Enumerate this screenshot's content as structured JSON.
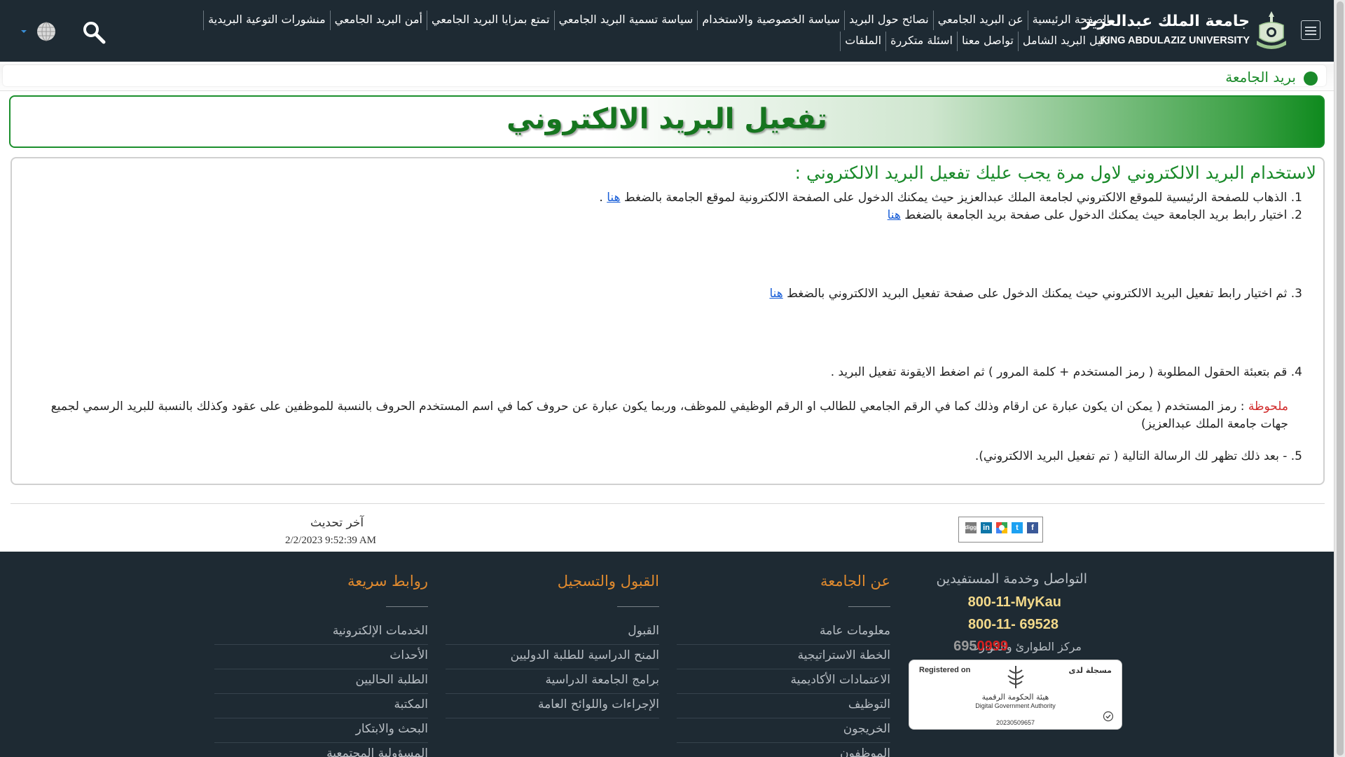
{
  "header": {
    "brand_ar": "جامعة الملك عبدالعزيز",
    "brand_en": "KING ABDULAZIZ UNIVERSITY",
    "nav_row1": [
      "الصفحة الرئيسية",
      "عن البريد الجامعي",
      "نصائح حول البريد",
      "سياسة الخصوصية والاستخدام",
      "سياسة تسمية البريد الجامعي",
      "تمتع بمزايا البريد الجامعي",
      "أمن البريد الجامعي",
      "منشورات التوعية البريدية"
    ],
    "nav_row2": [
      "دليل البريد الشامل",
      "تواصل معنا",
      "اسئلة متكررة",
      "الملفات"
    ]
  },
  "breadcrumb": {
    "label": "بريد الجامعة"
  },
  "banner": {
    "title": "تفعيل البريد الالكتروني"
  },
  "content": {
    "heading": "لاستخدام البريد الالكتروني لاول مرة يجب عليك تفعيل البريد الالكتروني :",
    "step1_prefix": "1. الذهاب للصفحة الرئيسية للموقع الالكتروني لجامعة الملك عبدالعزيز حيث يمكنك الدخول على الصفحة الالكترونية لموقع الجامعة بالضغط ",
    "step1_link": "هنا",
    "step1_suffix": " .",
    "step2_prefix": "2. اختيار رابط بريد الجامعة حيث يمكنك الدخول على صفحة بريد الجامعة بالضغط ",
    "step2_link": "هنا",
    "step3_prefix": "3. ثم اختيار رابط تفعيل البريد الالكتروني حيث يمكنك الدخول على صفحة تفعيل البريد الالكتروني بالضغط ",
    "step3_link": "هنا",
    "step4": "4. قم بتعبئة الحقول المطلوبة ( رمز المستخدم + كلمة المرور ) ثم اضغط الايقونة تفعيل البريد .",
    "note_label": "ملحوظة",
    "note_text": " : رمز المستخدم ( يمكن ان يكون عبارة عن ارقام وذلك كما في الرقم الجامعي للطالب او الرقم الوظيفي للموظف، وربما يكون عبارة عن حروف كما في اسم المستخدم الحروف بالنسبة للموظفين على عقود وكذلك بالنسبة للبريد الرسمي لجميع جهات جامعة الملك عبدالعزيز)",
    "step5": "5. - بعد ذلك تظهر لك الرسالة التالية ( تم تفعيل البريد الالكتروني)."
  },
  "share": {
    "icons": [
      "facebook-icon",
      "twitter-icon",
      "google-plus-icon",
      "linkedin-icon",
      "digg-icon"
    ]
  },
  "last_update": {
    "label": "آخر تحديث",
    "value": "2/2/2023 9:52:39 AM"
  },
  "footer": {
    "support_title": "التواصل وخدمة المستفيدين",
    "phone1": "800-11-MyKau",
    "phone2": "800-11- 69528",
    "emergency_label": "مركز الطوارئ والكوارث",
    "emergency_num_a": "695",
    "emergency_num_b": "0999",
    "badge_registered_en": "Registered on",
    "badge_registered_ar": "مسجلة لدى",
    "badge_authority_ar": "هيئة الحكومة الرقمية",
    "badge_authority_en": "Digital Government Authority",
    "badge_number": "20230509657",
    "col_about_title": "عن الجامعة",
    "col_about_links": [
      "معلومات عامة",
      "الخطة الاستراتيجية",
      "الاعتمادات الأكاديمية",
      "التوظيف",
      "الخريجون",
      "الموظفون"
    ],
    "col_admission_title": "القبول والتسجيل",
    "col_admission_links": [
      "القبول",
      "المنح الدراسية للطلبة الدوليين",
      "برامج الجامعة الدراسية",
      "الإجراءات واللوائح العامة"
    ],
    "col_quick_title": "روابط سريعة",
    "col_quick_links": [
      "الخدمات الإلكترونية",
      "الأحداث",
      "الطلبة الحاليين",
      "المكتبة",
      "البحث والابتكار",
      "المسؤولية المجتمعية"
    ]
  },
  "colors": {
    "header_bg": "#1e2a33",
    "accent_green": "#1a8a2a",
    "footer_title": "#e08a2e",
    "phone_gold": "#f3d98a",
    "emergency_red": "#d42020"
  }
}
